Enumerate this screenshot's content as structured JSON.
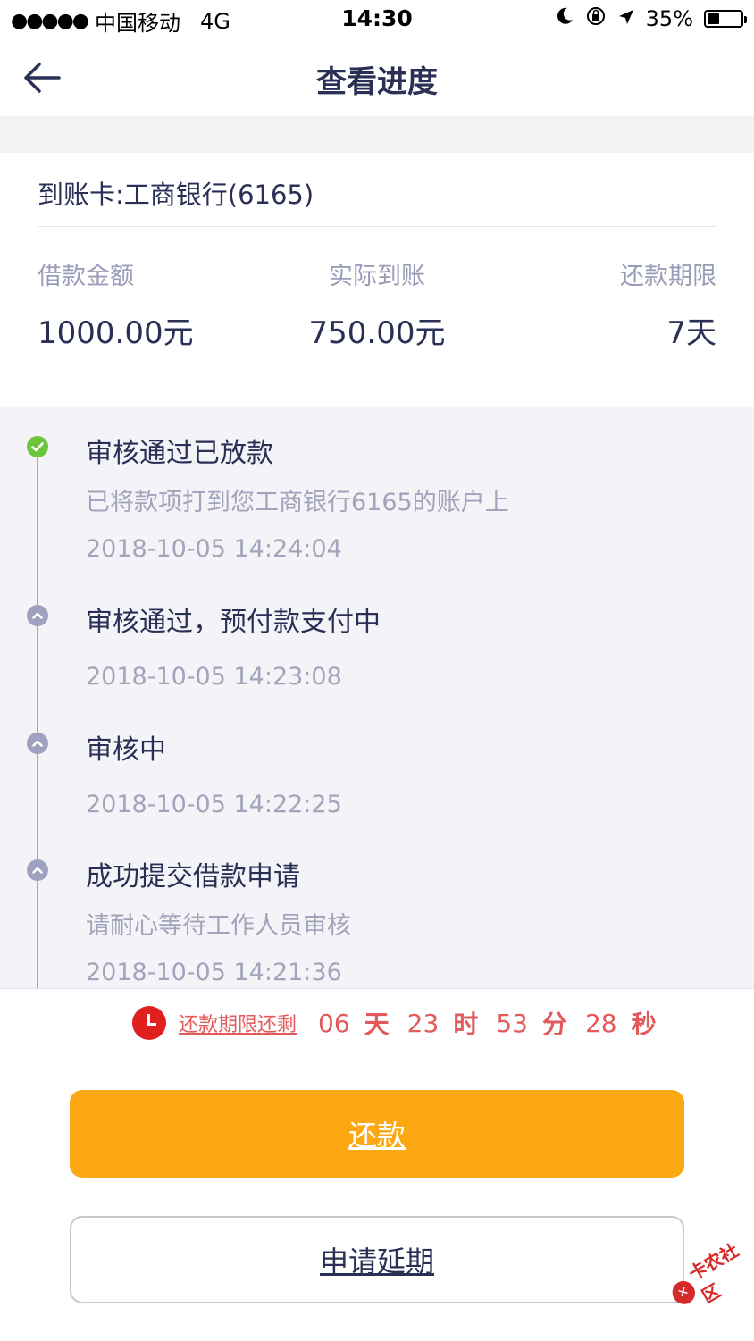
{
  "status_bar": {
    "signal_dots": "●●●●●",
    "carrier": "中国移动",
    "network": "4G",
    "time": "14:30",
    "battery": "35%",
    "battery_level": 0.35
  },
  "nav": {
    "title": "查看进度"
  },
  "card": {
    "account_line": "到账卡:工商银行(6165)",
    "summary": [
      {
        "label": "借款金额",
        "value": "1000.00元"
      },
      {
        "label": "实际到账",
        "value": "750.00元"
      },
      {
        "label": "还款期限",
        "value": "7天"
      }
    ]
  },
  "timeline": [
    {
      "title": "审核通过已放款",
      "desc": "已将款项打到您工商银行6165的账户上",
      "time": "2018-10-05 14:24:04",
      "done": true
    },
    {
      "title": "审核通过，预付款支付中",
      "desc": "",
      "time": "2018-10-05 14:23:08",
      "done": false
    },
    {
      "title": "审核中",
      "desc": "",
      "time": "2018-10-05 14:22:25",
      "done": false
    },
    {
      "title": "成功提交借款申请",
      "desc": "请耐心等待工作人员审核",
      "time": "2018-10-05 14:21:36",
      "done": false
    }
  ],
  "countdown": {
    "label": "还款期限还剩",
    "days": "06",
    "days_unit": "天",
    "hours": "23",
    "hours_unit": "时",
    "minutes": "53",
    "minutes_unit": "分",
    "seconds": "28",
    "seconds_unit": "秒"
  },
  "actions": {
    "repay_label": "还款",
    "extend_label": "申请延期"
  },
  "watermark": {
    "text": "卡农社区"
  },
  "colors": {
    "primary": "#2a2f55",
    "accent_orange": "#fca812",
    "success_green": "#6cc63c",
    "danger_red": "#e0201f"
  }
}
